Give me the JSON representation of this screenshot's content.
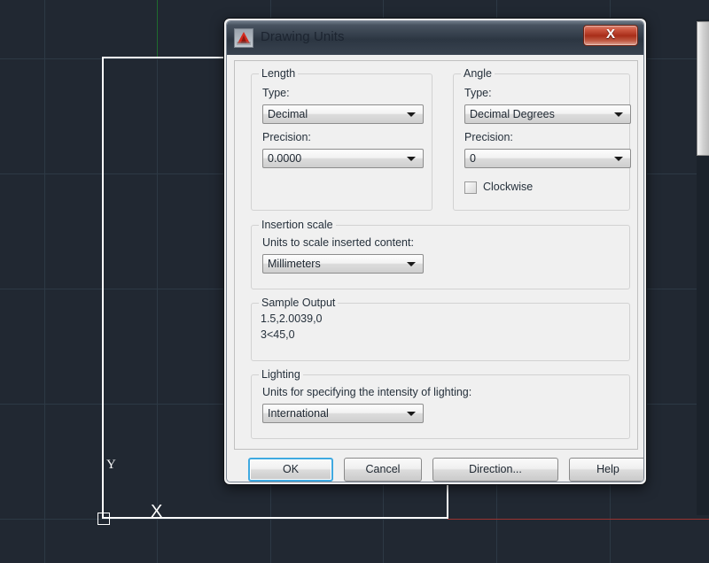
{
  "canvas": {
    "name": "autocad-drawing-area",
    "background_color": "#212832",
    "grid_color": "#2d3945",
    "y_axis_color": "#1e6b2e",
    "x_axis_color": "#9b3330",
    "geometry_color": "#ffffff",
    "ucs": {
      "x_label": "X",
      "y_label": "Y"
    }
  },
  "dialog": {
    "title": "Drawing Units",
    "icon": "autocad-logo-icon",
    "close_label": "X",
    "length": {
      "legend": "Length",
      "type_label": "Type:",
      "type_value": "Decimal",
      "precision_label": "Precision:",
      "precision_value": "0.0000"
    },
    "angle": {
      "legend": "Angle",
      "type_label": "Type:",
      "type_value": "Decimal Degrees",
      "precision_label": "Precision:",
      "precision_value": "0",
      "clockwise_label": "Clockwise",
      "clockwise_checked": false
    },
    "insertion_scale": {
      "legend": "Insertion scale",
      "units_label": "Units to scale inserted content:",
      "units_value": "Millimeters"
    },
    "sample_output": {
      "legend": "Sample Output",
      "line1": "1.5,2.0039,0",
      "line2": "3<45,0"
    },
    "lighting": {
      "legend": "Lighting",
      "units_label": "Units for specifying the intensity of lighting:",
      "units_value": "International"
    },
    "buttons": {
      "ok": "OK",
      "cancel": "Cancel",
      "direction": "Direction...",
      "help": "Help"
    },
    "accent_focus_color": "#3fa9e0",
    "close_button_color": "#a82d19"
  }
}
